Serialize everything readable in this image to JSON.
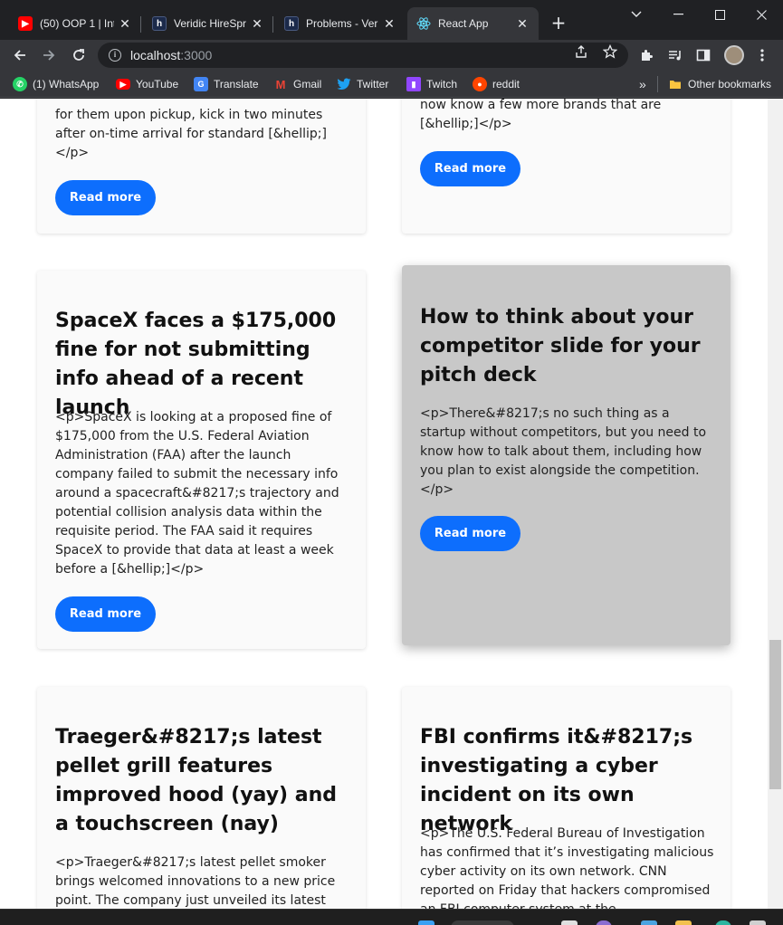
{
  "browser": {
    "tabs": [
      {
        "title": "(50) OOP 1 | Int",
        "favicon": "youtube-icon",
        "favicon_color": "#ff0000"
      },
      {
        "title": "Veridic HireSpri",
        "favicon": "h-icon",
        "favicon_color": "#1c2a4a"
      },
      {
        "title": "Problems - Veri",
        "favicon": "h-icon",
        "favicon_color": "#1c2a4a"
      },
      {
        "title": "React App",
        "favicon": "react-icon",
        "favicon_color": "#61dafb",
        "active": true
      }
    ],
    "address": {
      "host": "localhost",
      "port": ":3000"
    },
    "bookmarks": [
      {
        "label": "(1) WhatsApp",
        "icon": "whatsapp-icon",
        "color": "#25d366"
      },
      {
        "label": "YouTube",
        "icon": "youtube-icon",
        "color": "#ff0000"
      },
      {
        "label": "Translate",
        "icon": "translate-icon",
        "color": "#4285f4"
      },
      {
        "label": "Gmail",
        "icon": "gmail-icon",
        "color": "#ea4335"
      },
      {
        "label": "Twitter",
        "icon": "twitter-icon",
        "color": "#1da1f2"
      },
      {
        "label": "Twitch",
        "icon": "twitch-icon",
        "color": "#9146ff"
      },
      {
        "label": "reddit",
        "icon": "reddit-icon",
        "color": "#ff4500"
      }
    ],
    "overflow_label": "»",
    "other_bookmarks": "Other bookmarks"
  },
  "page": {
    "read_more": "Read more",
    "accent_color": "#0d6efd",
    "cards": [
      {
        "id": "top-left",
        "title": "",
        "excerpt": "for them upon pickup, kick in two minutes after on-time arrival for standard [&hellip;]</p>"
      },
      {
        "id": "top-right",
        "title": "",
        "excerpt": "now know a few more brands that are [&hellip;]</p>"
      },
      {
        "id": "spacex",
        "title": "SpaceX faces a $175,000 fine for not submitting info ahead of a recent launch",
        "excerpt": "<p>SpaceX is looking at a proposed fine of $175,000 from the U.S. Federal Aviation Administration (FAA) after the launch company failed to submit the necessary info around a spacecraft&#8217;s trajectory and potential collision analysis data within the requisite period. The FAA said it requires SpaceX to provide that data at least a week before a [&hellip;]</p>"
      },
      {
        "id": "competitor-slide",
        "title": "How to think about your competitor slide for your pitch deck",
        "excerpt": "<p>There&#8217;s no such thing as a startup without competitors, but you need to know how to talk about them, including how you plan to exist alongside the competition.</p>",
        "hovered": true
      },
      {
        "id": "traeger",
        "title": "Traeger&#8217;s latest pellet grill features improved hood (yay) and a touchscreen (nay)",
        "excerpt": "<p>Traeger&#8217;s latest pellet smoker brings welcomed innovations to a new price point. The company just unveiled its latest"
      },
      {
        "id": "fbi",
        "title": "FBI confirms it&#8217;s investigating a cyber incident on its own network",
        "excerpt": "<p>The U.S. Federal Bureau of Investigation has confirmed that it’s investigating malicious cyber activity on its own network. CNN reported on Friday that hackers compromised an FBI computer system at the"
      }
    ]
  }
}
